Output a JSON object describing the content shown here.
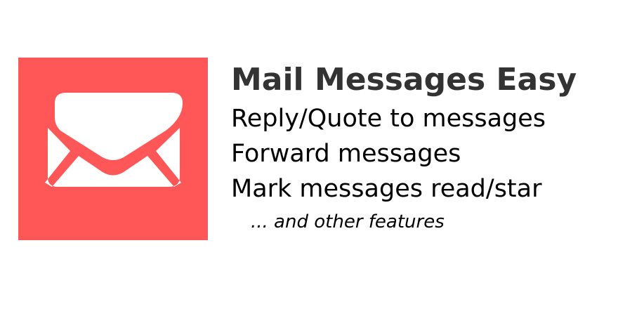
{
  "brand": {
    "tile_color": "#ff5757",
    "icon_color": "#ffffff",
    "icon": "envelope-icon"
  },
  "title": "Mail Messages Easy",
  "title_color": "#333333",
  "features": [
    "Reply/Quote to messages",
    "Forward messages",
    "Mark messages read/star"
  ],
  "more_note": "... and other features"
}
